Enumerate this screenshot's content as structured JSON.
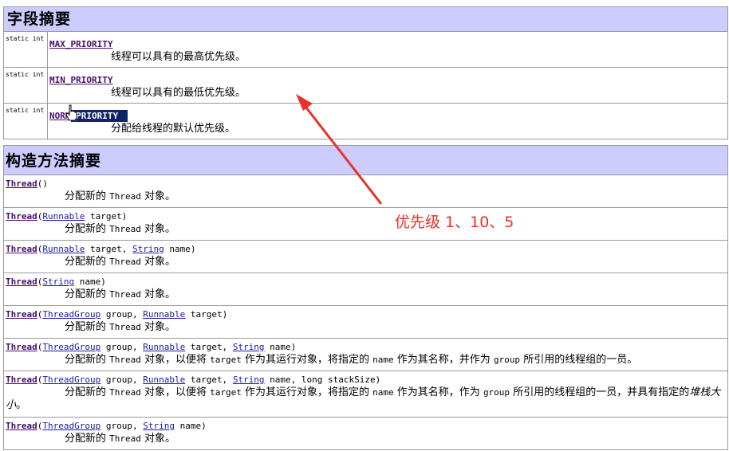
{
  "field_summary": {
    "title": "字段摘要",
    "fields": [
      {
        "modifier": "static int",
        "name": "MAX_PRIORITY",
        "description": "线程可以具有的最高优先级。"
      },
      {
        "modifier": "static int",
        "name": "MIN_PRIORITY",
        "description": "线程可以具有的最低优先级。"
      },
      {
        "modifier": "static int",
        "name_part1": "NORM",
        "name_part2": "_PRIORITY",
        "description": "分配给线程的默认优先级。"
      }
    ]
  },
  "constructor_summary": {
    "title": "构造方法摘要",
    "desc_prefix": "分配新的 ",
    "thread_word": "Thread",
    "desc_suffix": " 对象。",
    "long_desc_mid1": " 对象，以便将 ",
    "target_word": "target",
    "long_desc_mid2": " 作为其运行对象，将指定的 ",
    "name_word": "name",
    "long_desc_mid3": " 作为其名称，并作为 ",
    "long_desc_mid3b": " 作为其名称，作为 ",
    "group_word": "group",
    "long_desc_end": " 所引用的线程组的一员。",
    "long_desc_end2": " 所引用的线程组的一员，并具有指定的",
    "stack_size_italic": "堆栈大小",
    "period": "。",
    "sig": {
      "thread": "Thread",
      "empty_parens": "()",
      "open": "(",
      "close": ")",
      "runnable": "Runnable",
      "string": "String",
      "threadgroup": "ThreadGroup",
      "p_target": " target",
      "p_target_comma": " target, ",
      "p_name": " name",
      "p_name_long": " name, long stackSize",
      "p_group_comma": " group, "
    }
  },
  "annotation": {
    "text": "优先级 1、10、5",
    "color": "#e8322a"
  },
  "colors": {
    "header_bg": "#ccccff",
    "link_purple": "#4a0d6e",
    "link_blue": "#1a1aa6",
    "selection_bg": "#10246a"
  }
}
